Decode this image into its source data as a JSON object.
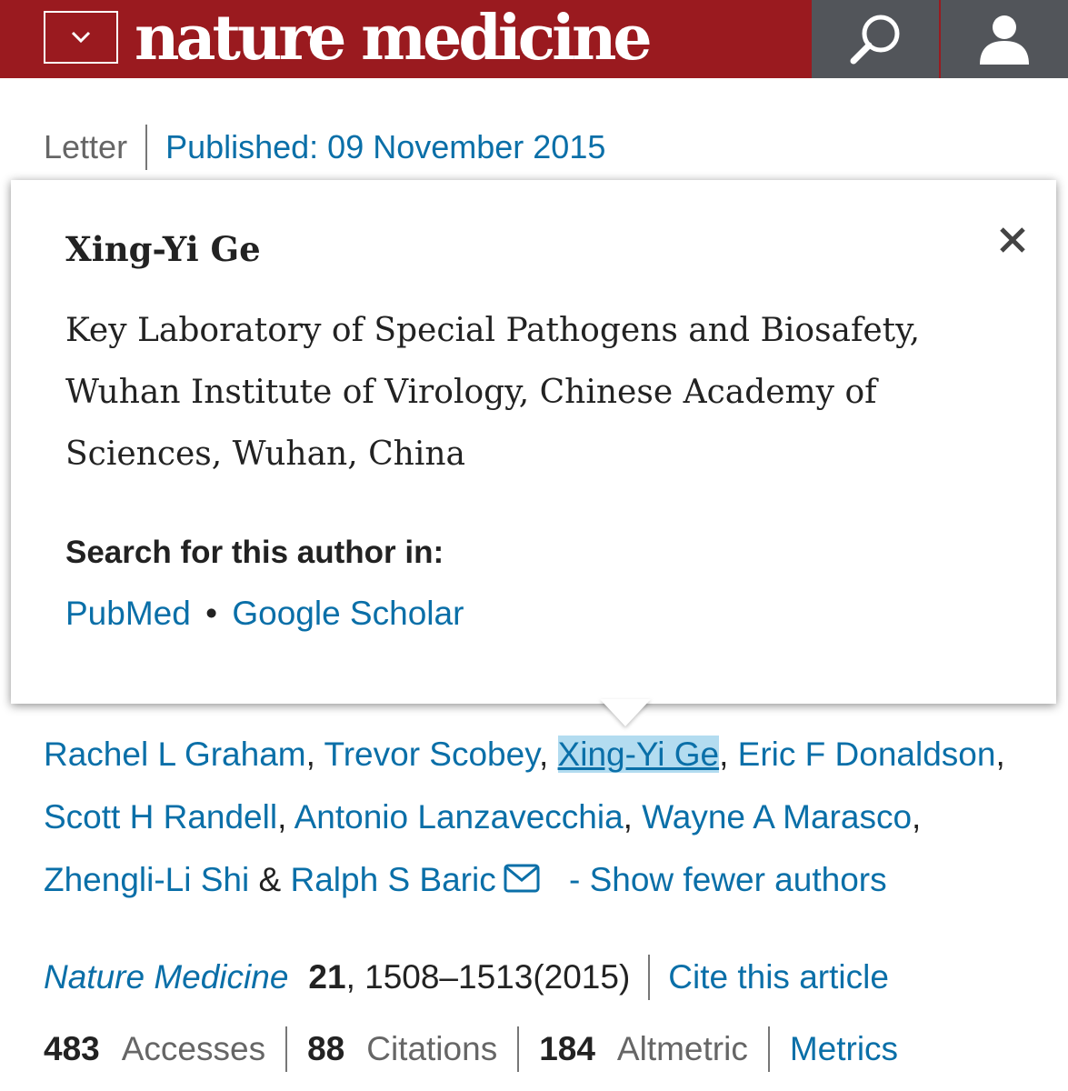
{
  "header": {
    "logo_text": "nature medicine",
    "brand_color": "#9a1a1f",
    "icon_bar_color": "#52555a",
    "menu_icon": "chevron-down-icon",
    "search_icon": "search-icon",
    "user_icon": "user-icon"
  },
  "article_meta": {
    "type": "Letter",
    "published": "Published: 09 November 2015"
  },
  "author_popup": {
    "name": "Xing-Yi Ge",
    "affiliation": "Key Laboratory of Special Pathogens and Biosafety, Wuhan Institute of Virology, Chinese Academy of Sciences, Wuhan, China",
    "search_title": "Search for this author in:",
    "links": [
      "PubMed",
      "Google Scholar"
    ],
    "separator": "•",
    "close_icon": "close-icon"
  },
  "authors": {
    "list": [
      "Rachel L Graham",
      "Trevor Scobey",
      "Xing-Yi Ge",
      "Eric F Donaldson",
      "Scott H Randell",
      "Antonio Lanzavecchia",
      "Wayne A Marasco",
      "Zhengli-Li Shi",
      "Ralph S Baric"
    ],
    "comma": ",",
    "ampersand": "&",
    "show_fewer": "- Show fewer authors",
    "mail_icon": "mail-icon",
    "link_color": "#0a6fa8",
    "highlight_color": "#b3dcf0"
  },
  "citation": {
    "journal": "Nature Medicine",
    "volume": "21",
    "pages": ", 1508–1513",
    "year": "(2015)",
    "cite_link": "Cite this article"
  },
  "metrics": {
    "accesses_count": "483",
    "accesses_label": "Accesses",
    "citations_count": "88",
    "citations_label": "Citations",
    "altmetric_count": "184",
    "altmetric_label": "Altmetric",
    "metrics_link": "Metrics"
  }
}
